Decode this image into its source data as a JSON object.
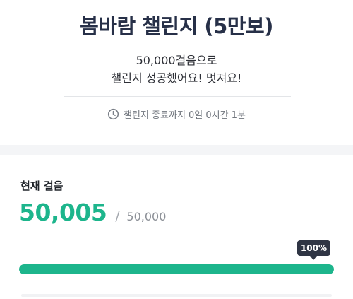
{
  "challenge": {
    "title": "봄바람 챌린지 (5만보)",
    "message_line1": "50,000걸음으로",
    "message_line2": "챌린지 성공했어요! 멋져요!",
    "ends_in": "챌린지 종료까지 0일 0시간 1분",
    "clock_icon": "clock-icon"
  },
  "progress": {
    "label": "현재 걸음",
    "current_steps": "50,005",
    "separator": "/",
    "goal_steps": "50,000",
    "percent_label": "100%",
    "percent": 100
  },
  "colors": {
    "accent": "#1db58c",
    "title": "#273048",
    "badge_bg": "#2f3544"
  }
}
